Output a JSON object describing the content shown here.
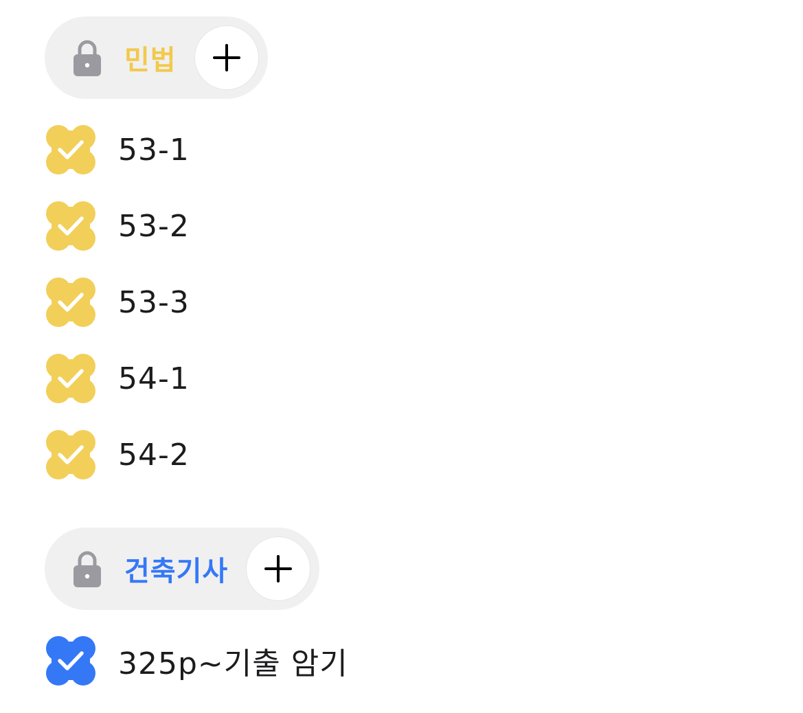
{
  "categories": [
    {
      "name": "민법",
      "color": "#f2c94c",
      "lock_icon": "lock-icon",
      "add_icon": "plus-icon",
      "todos": [
        {
          "text": "53-1",
          "done": true
        },
        {
          "text": "53-2",
          "done": true
        },
        {
          "text": "53-3",
          "done": true
        },
        {
          "text": "54-1",
          "done": true
        },
        {
          "text": "54-2",
          "done": true
        }
      ]
    },
    {
      "name": "건축기사",
      "color": "#3478f6",
      "lock_icon": "lock-icon",
      "add_icon": "plus-icon",
      "todos": [
        {
          "text": "325p~기출 암기",
          "done": true
        }
      ]
    }
  ],
  "colors": {
    "lock": "#9a9aa0",
    "pill_bg": "#f0f0f1",
    "text": "#1c1c1e"
  }
}
